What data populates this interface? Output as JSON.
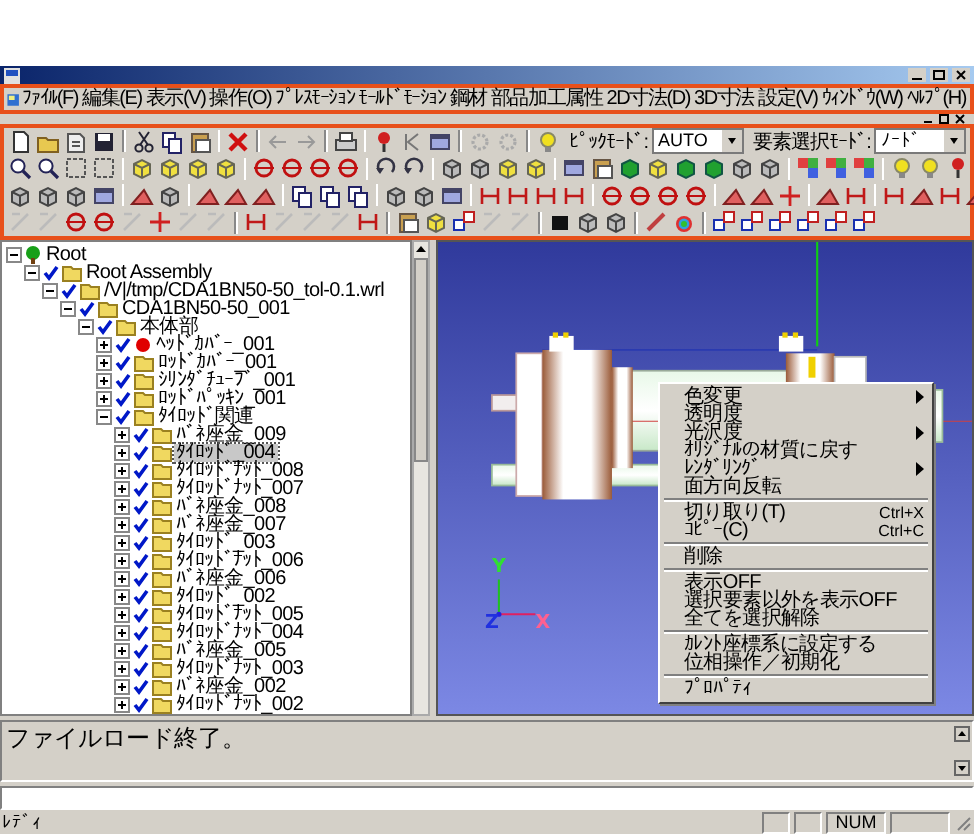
{
  "menu_bar": {
    "items": [
      "ﾌｧｲﾙ(F)",
      "編集(E)",
      "表示(V)",
      "操作(O)",
      "ﾌﾟﾚｽﾓｰｼｮﾝ",
      "ﾓｰﾙﾄﾞﾓｰｼｮﾝ",
      "鋼材",
      "部品加工属性",
      "2D寸法(D)",
      "3D寸法",
      "設定(V)",
      "ｳｨﾝﾄﾞｳ(W)",
      "ﾍﾙﾌﾟ(H)"
    ]
  },
  "toolbar": {
    "pick_mode": {
      "label": "ﾋﾟｯｸﾓｰﾄﾞ:",
      "value": "AUTO"
    },
    "element_select_mode": {
      "label": "要素選択ﾓｰﾄﾞ:",
      "value": "ﾉｰﾄﾞ"
    }
  },
  "tree": {
    "items": [
      {
        "label": "Root",
        "kind": "root",
        "expanded": true,
        "selected": false,
        "children": [
          {
            "label": "Root Assembly",
            "kind": "folder",
            "checked": true,
            "expanded": true,
            "selected": false,
            "children": [
              {
                "label": "/V|/tmp/CDA1BN50-50_tol-0.1.wrl",
                "kind": "folder",
                "checked": true,
                "expanded": true,
                "selected": false,
                "children": [
                  {
                    "label": "CDA1BN50-50_001",
                    "kind": "folder",
                    "checked": true,
                    "expanded": true,
                    "selected": false,
                    "children": [
                      {
                        "label": "本体部",
                        "kind": "folder",
                        "checked": true,
                        "expanded": true,
                        "selected": false,
                        "children": [
                          {
                            "label": "ﾍｯﾄﾞｶﾊﾞｰ_001",
                            "kind": "part",
                            "checked": true,
                            "expanded": false,
                            "selected": false
                          },
                          {
                            "label": "ﾛｯﾄﾞｶﾊﾞｰ_001",
                            "kind": "folder",
                            "checked": true,
                            "expanded": false,
                            "selected": false
                          },
                          {
                            "label": "ｼﾘﾝﾀﾞﾁｭｰﾌﾞ_001",
                            "kind": "folder",
                            "checked": true,
                            "expanded": false,
                            "selected": false
                          },
                          {
                            "label": "ﾛｯﾄﾞﾊﾟｯｷﾝ_001",
                            "kind": "folder",
                            "checked": true,
                            "expanded": false,
                            "selected": false
                          },
                          {
                            "label": "ﾀｲﾛｯﾄﾞ関連",
                            "kind": "folder",
                            "checked": true,
                            "expanded": true,
                            "selected": false,
                            "children": [
                              {
                                "label": "ﾊﾞﾈ座金_009",
                                "kind": "folder",
                                "checked": true,
                                "expanded": false,
                                "selected": false
                              },
                              {
                                "label": "ﾀｲﾛｯﾄﾞ_004",
                                "kind": "folder",
                                "checked": true,
                                "expanded": false,
                                "selected": true
                              },
                              {
                                "label": "ﾀｲﾛｯﾄﾞﾅｯﾄ_008",
                                "kind": "folder",
                                "checked": true,
                                "expanded": false,
                                "selected": false
                              },
                              {
                                "label": "ﾀｲﾛｯﾄﾞﾅｯﾄ_007",
                                "kind": "folder",
                                "checked": true,
                                "expanded": false,
                                "selected": false
                              },
                              {
                                "label": "ﾊﾞﾈ座金_008",
                                "kind": "folder",
                                "checked": true,
                                "expanded": false,
                                "selected": false
                              },
                              {
                                "label": "ﾊﾞﾈ座金_007",
                                "kind": "folder",
                                "checked": true,
                                "expanded": false,
                                "selected": false
                              },
                              {
                                "label": "ﾀｲﾛｯﾄﾞ_003",
                                "kind": "folder",
                                "checked": true,
                                "expanded": false,
                                "selected": false
                              },
                              {
                                "label": "ﾀｲﾛｯﾄﾞﾅｯﾄ_006",
                                "kind": "folder",
                                "checked": true,
                                "expanded": false,
                                "selected": false
                              },
                              {
                                "label": "ﾊﾞﾈ座金_006",
                                "kind": "folder",
                                "checked": true,
                                "expanded": false,
                                "selected": false
                              },
                              {
                                "label": "ﾀｲﾛｯﾄﾞ_002",
                                "kind": "folder",
                                "checked": true,
                                "expanded": false,
                                "selected": false
                              },
                              {
                                "label": "ﾀｲﾛｯﾄﾞﾅｯﾄ_005",
                                "kind": "folder",
                                "checked": true,
                                "expanded": false,
                                "selected": false
                              },
                              {
                                "label": "ﾀｲﾛｯﾄﾞﾅｯﾄ_004",
                                "kind": "folder",
                                "checked": true,
                                "expanded": false,
                                "selected": false
                              },
                              {
                                "label": "ﾊﾞﾈ座金_005",
                                "kind": "folder",
                                "checked": true,
                                "expanded": false,
                                "selected": false
                              },
                              {
                                "label": "ﾀｲﾛｯﾄﾞﾅｯﾄ_003",
                                "kind": "folder",
                                "checked": true,
                                "expanded": false,
                                "selected": false
                              },
                              {
                                "label": "ﾊﾞﾈ座金_002",
                                "kind": "folder",
                                "checked": true,
                                "expanded": false,
                                "selected": false
                              },
                              {
                                "label": "ﾀｲﾛｯﾄﾞﾅｯﾄ_002",
                                "kind": "folder",
                                "checked": true,
                                "expanded": false,
                                "selected": false
                              }
                            ]
                          }
                        ]
                      }
                    ]
                  }
                ]
              }
            ]
          }
        ]
      }
    ]
  },
  "viewport": {
    "axes": [
      {
        "label": "Y"
      },
      {
        "label": "Z"
      },
      {
        "label": "X"
      }
    ]
  },
  "context_menu": {
    "groups": [
      [
        {
          "label": "色変更",
          "submenu": true
        },
        {
          "label": "透明度",
          "submenu": false
        },
        {
          "label": "光沢度",
          "submenu": true
        },
        {
          "label": "ｵﾘｼﾞﾅﾙの材質に戻す",
          "submenu": false
        },
        {
          "label": "ﾚﾝﾀﾞﾘﾝｸﾞ",
          "submenu": true
        },
        {
          "label": "面方向反転",
          "submenu": false
        }
      ],
      [
        {
          "label": "切り取り(T)",
          "submenu": false,
          "shortcut": "Ctrl+X"
        },
        {
          "label": "ｺﾋﾟｰ(C)",
          "submenu": false,
          "shortcut": "Ctrl+C"
        }
      ],
      [
        {
          "label": "削除",
          "submenu": false
        }
      ],
      [
        {
          "label": "表示OFF",
          "submenu": false
        },
        {
          "label": "選択要素以外を表示OFF",
          "submenu": false
        },
        {
          "label": "全てを選択解除",
          "submenu": false
        }
      ],
      [
        {
          "label": "ｶﾚﾝﾄ座標系に設定する",
          "submenu": false
        },
        {
          "label": "位相操作／初期化",
          "submenu": false
        }
      ],
      [
        {
          "label": "ﾌﾟﾛﾊﾟﾃｨ",
          "submenu": false
        }
      ]
    ]
  },
  "message_pane": {
    "text": "ファイルロード終了。"
  },
  "status_bar": {
    "text": "ﾚﾃﾞｨ",
    "num_indicator": "NUM"
  }
}
